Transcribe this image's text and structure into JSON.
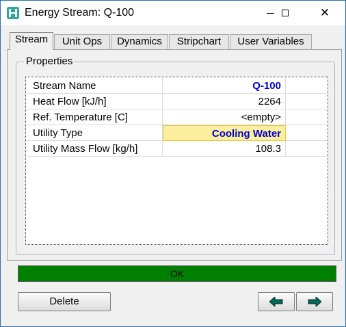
{
  "window": {
    "title": "Energy Stream: Q-100",
    "close_glyph": "✕"
  },
  "tabs": [
    {
      "label": "Stream",
      "active": true
    },
    {
      "label": "Unit Ops",
      "active": false
    },
    {
      "label": "Dynamics",
      "active": false
    },
    {
      "label": "Stripchart",
      "active": false
    },
    {
      "label": "User Variables",
      "active": false
    }
  ],
  "properties": {
    "group_label": "Properties",
    "rows": [
      {
        "label": "Stream Name",
        "value": "Q-100"
      },
      {
        "label": "Heat Flow [kJ/h]",
        "value": "2264"
      },
      {
        "label": "Ref. Temperature [C]",
        "value": "<empty>"
      },
      {
        "label": "Utility Type",
        "value": "Cooling Water"
      },
      {
        "label": "Utility Mass Flow [kg/h]",
        "value": "108.3"
      }
    ]
  },
  "status": {
    "text": "OK",
    "color": "#008000"
  },
  "buttons": {
    "delete": "Delete"
  },
  "icons": {
    "app": "app-logo-icon",
    "prev": "arrow-left-icon",
    "next": "arrow-right-icon",
    "arrow_color": "#006b5c"
  },
  "colors": {
    "accent_text": "#0000cc",
    "highlight": "#fbee9c"
  }
}
